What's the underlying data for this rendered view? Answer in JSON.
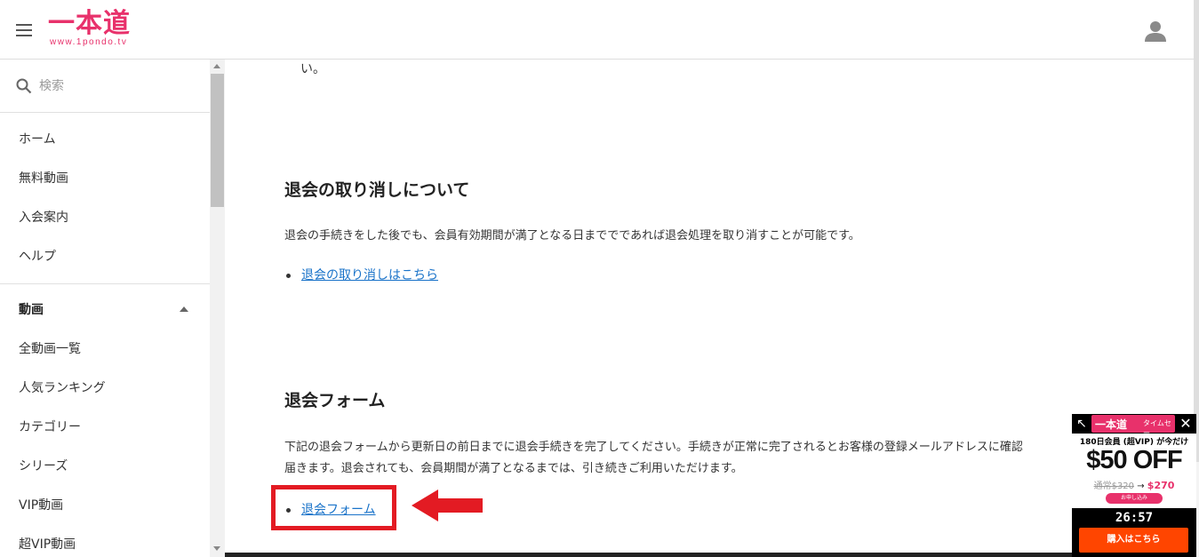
{
  "header": {
    "logo_text": "一本道",
    "logo_url_text": "www.1pondo.tv",
    "menu_icon": "hamburger-icon",
    "user_icon": "user-icon",
    "brand_color": "#e8316b"
  },
  "sidebar": {
    "search_placeholder": "検索",
    "items": [
      {
        "label": "ホーム"
      },
      {
        "label": "無料動画"
      },
      {
        "label": "入会案内"
      },
      {
        "label": "ヘルプ"
      }
    ],
    "section_title": "動画",
    "section_items": [
      {
        "label": "全動画一覧"
      },
      {
        "label": "人気ランキング"
      },
      {
        "label": "カテゴリー"
      },
      {
        "label": "シリーズ"
      },
      {
        "label": "VIP動画"
      },
      {
        "label": "超VIP動画"
      }
    ]
  },
  "main": {
    "residual_text": "い。",
    "cancel_section": {
      "title": "退会の取り消しについて",
      "description": "退会の手続きをした後でも、会員有効期間が満了となる日まででであれば退会処理を取り消すことが可能です。",
      "link": "退会の取り消しはこちら"
    },
    "form_section": {
      "title": "退会フォーム",
      "description_line1": "下記の退会フォームから更新日の前日までに退会手続きを完了してください。手続きが正常に完了されるとお客様の登録メールアドレスに確認",
      "description_line2": "届きます。退会されても、会員期間が満了となるまでは、引き続きご利用いただけます。",
      "link": "退会フォーム"
    },
    "annotation_color": "#e31b23"
  },
  "ad": {
    "logo": "一本道",
    "tag": "タイムセー",
    "line1": "180日会員 (超VIP) が今だけ",
    "big": "$50 OFF",
    "old_price": "通常$320",
    "arrow": "→",
    "new_price": "$270",
    "apply": "お申し込み",
    "timer": "26:57",
    "buy_button": "購入はこちら",
    "close": "✕",
    "expand": "↖"
  }
}
